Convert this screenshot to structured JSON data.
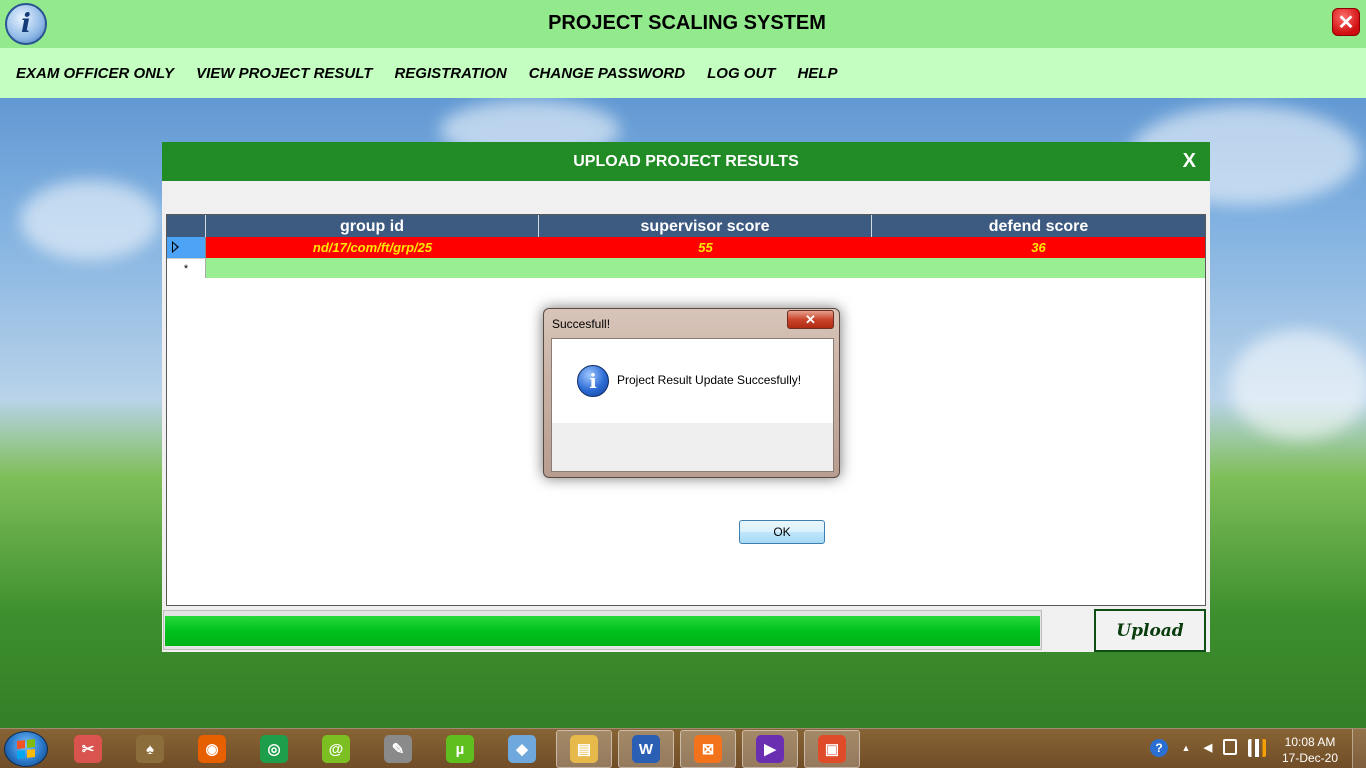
{
  "app": {
    "title": "PROJECT SCALING SYSTEM",
    "icon_glyph": "i",
    "close_glyph": "✕"
  },
  "menu": [
    {
      "label": "EXAM OFFICER ONLY"
    },
    {
      "label": "VIEW PROJECT RESULT"
    },
    {
      "label": "REGISTRATION"
    },
    {
      "label": "CHANGE PASSWORD"
    },
    {
      "label": "LOG OUT"
    },
    {
      "label": "HELP"
    }
  ],
  "upload_dialog": {
    "title": "UPLOAD PROJECT RESULTS",
    "close_glyph": "X",
    "grid": {
      "columns": [
        "group id",
        "supervisor score",
        "defend score"
      ],
      "rows": [
        {
          "group_id": "nd/17/com/ft/grp/25",
          "supervisor_score": "55",
          "defend_score": "36"
        }
      ],
      "new_row_marker": "*"
    },
    "progress": 1.0,
    "upload_button": "Upload"
  },
  "message_box": {
    "title": "Succesfull!",
    "close_glyph": "✕",
    "icon": "info-icon",
    "icon_glyph": "i",
    "text": "Project Result Update Succesfully!",
    "ok_button": "OK"
  },
  "taskbar": {
    "apps": [
      {
        "name": "snipping-tool-icon",
        "glyph": "✂",
        "color": "#d9534f"
      },
      {
        "name": "games-icon",
        "glyph": "♠",
        "color": "#8a6d3b"
      },
      {
        "name": "firefox-icon",
        "glyph": "◉",
        "color": "#e66000"
      },
      {
        "name": "chrome-icon",
        "glyph": "◎",
        "color": "#1e9e4a"
      },
      {
        "name": "chameleon-icon",
        "glyph": "@",
        "color": "#7cbf22"
      },
      {
        "name": "pencil-tool-icon",
        "glyph": "✎",
        "color": "#8a8a8a"
      },
      {
        "name": "utorrent-icon",
        "glyph": "µ",
        "color": "#5fbf1f"
      },
      {
        "name": "cube-app-icon",
        "glyph": "◆",
        "color": "#6fa8dc"
      },
      {
        "name": "file-explorer-icon",
        "glyph": "▤",
        "color": "#e7b94a"
      },
      {
        "name": "word-icon",
        "glyph": "W",
        "color": "#2b5fb4"
      },
      {
        "name": "xampp-icon",
        "glyph": "⊠",
        "color": "#f2731c"
      },
      {
        "name": "visual-studio-icon",
        "glyph": "▶",
        "color": "#6a2fb0"
      },
      {
        "name": "running-app-icon",
        "glyph": "▣",
        "color": "#e04b2a"
      }
    ],
    "tray": {
      "help_glyph": "?",
      "chevron_glyph": "▲",
      "volume_glyph": "◀",
      "clock_time": "10:08 AM",
      "clock_date": "17-Dec-20"
    }
  }
}
